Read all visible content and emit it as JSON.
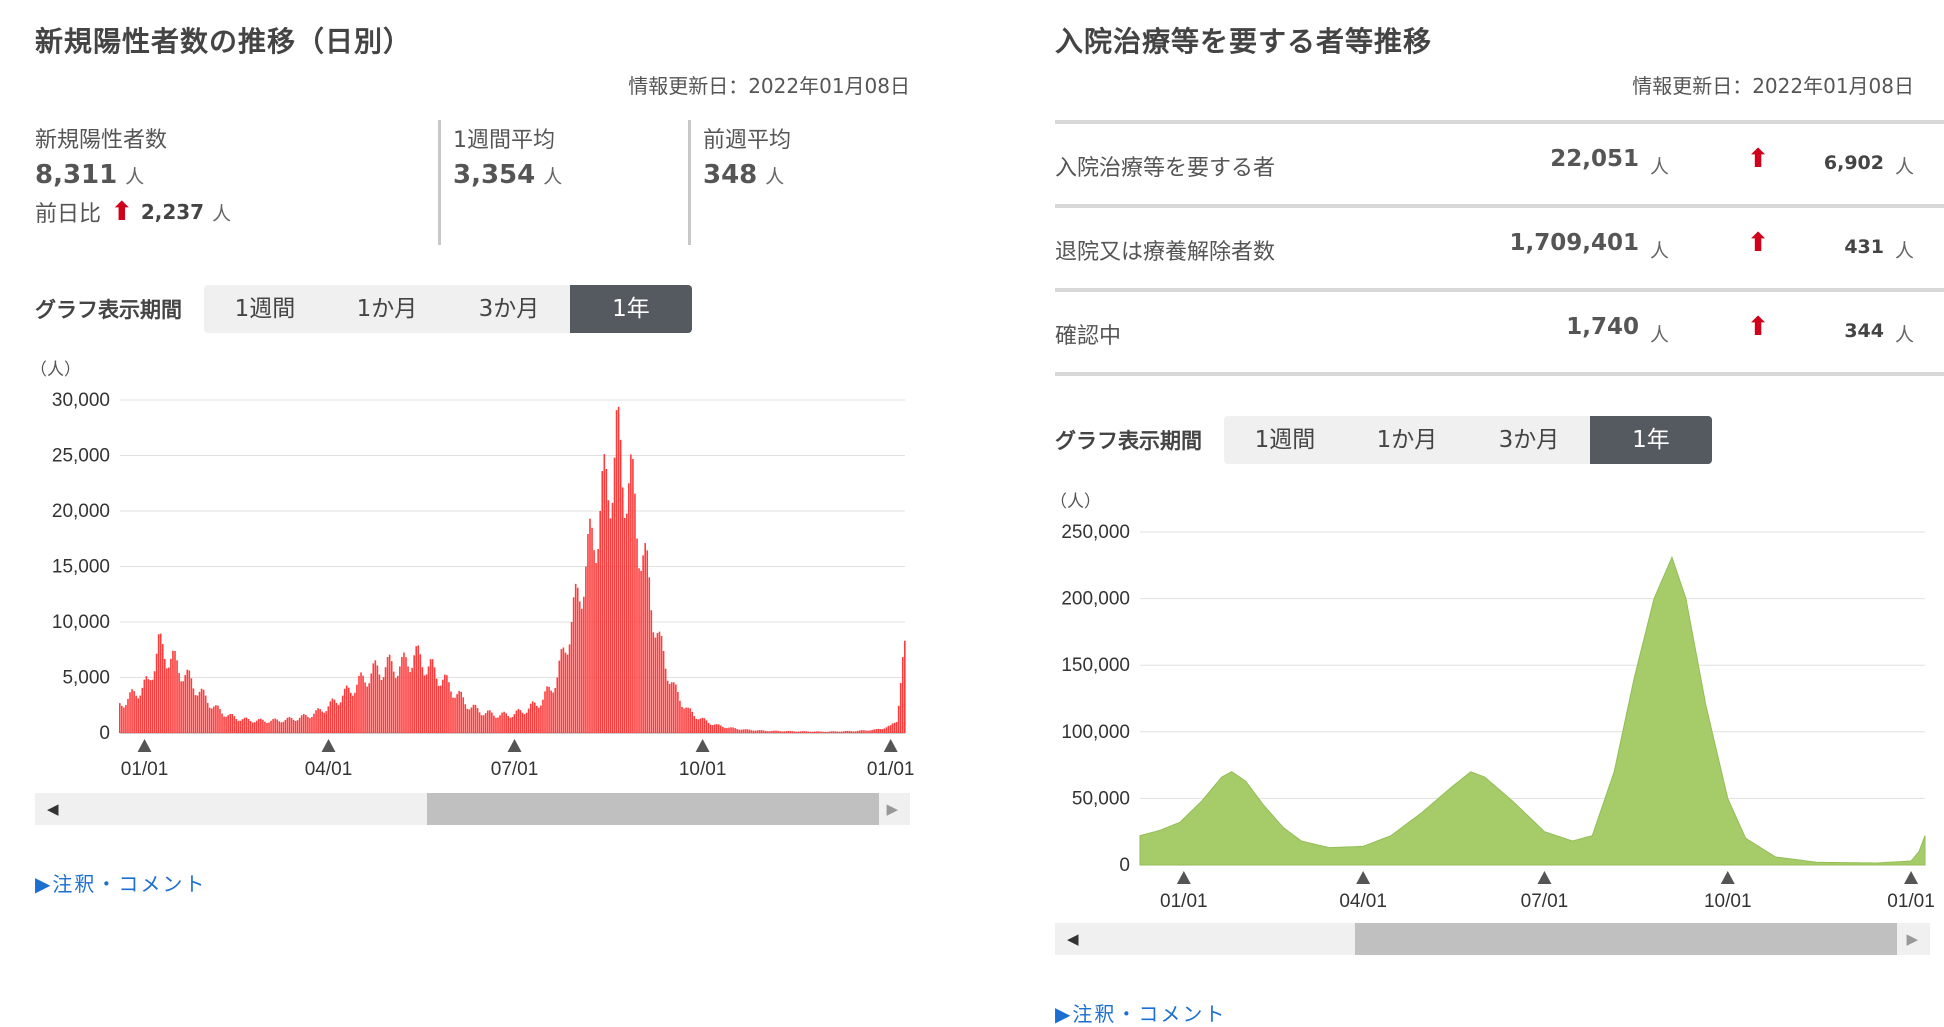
{
  "left": {
    "title": "新規陽性者数の推移（日別）",
    "updated": "情報更新日：2022年01月08日",
    "stats": {
      "new_label": "新規陽性者数",
      "new_value": "8,311",
      "unit": "人",
      "diff_label": "前日比",
      "diff_value": "2,237",
      "week_avg_label": "1週間平均",
      "week_avg_value": "3,354",
      "prev_week_label": "前週平均",
      "prev_week_value": "348"
    },
    "period_label": "グラフ表示期間",
    "period_buttons": [
      "1週間",
      "1か月",
      "3か月",
      "1年"
    ],
    "active_period": "1年",
    "note": "▶注釈・コメント"
  },
  "right": {
    "title": "入院治療等を要する者等推移",
    "updated": "情報更新日：2022年01月08日",
    "rows": [
      {
        "label": "入院治療等を要する者",
        "value": "22,051",
        "unit": "人",
        "diff": "6,902",
        "diff_unit": "人"
      },
      {
        "label": "退院又は療養解除者数",
        "value": "1,709,401",
        "unit": "人",
        "diff": "431",
        "diff_unit": "人"
      },
      {
        "label": "確認中",
        "value": "1,740",
        "unit": "人",
        "diff": "344",
        "diff_unit": "人"
      }
    ],
    "period_label": "グラフ表示期間",
    "period_buttons": [
      "1週間",
      "1か月",
      "3か月",
      "1年"
    ],
    "active_period": "1年",
    "note": "▶注釈・コメント"
  },
  "colors": {
    "red_series": "#ff3b3b",
    "green_series": "#a6cc6a",
    "active_button": "#555a60",
    "link": "#1a6fd0",
    "arrow": "#d0021b"
  },
  "chart_data": [
    {
      "type": "bar",
      "ylabel": "（人）",
      "ylim": [
        0,
        30000
      ],
      "yticks": [
        "30,000",
        "25,000",
        "20,000",
        "15,000",
        "10,000",
        "5,000",
        "0"
      ],
      "xticks": [
        "01/01",
        "04/01",
        "07/01",
        "10/01",
        "01/01"
      ],
      "x_range": [
        "2020-12-20",
        "2022-01-08"
      ],
      "series": [
        {
          "values_by_date": [
            [
              "2020-12-20",
              2500
            ],
            [
              "2020-12-27",
              3500
            ],
            [
              "2021-01-03",
              4500
            ],
            [
              "2021-01-08",
              7800
            ],
            [
              "2021-01-15",
              6500
            ],
            [
              "2021-01-22",
              5000
            ],
            [
              "2021-01-29",
              3500
            ],
            [
              "2021-02-05",
              2200
            ],
            [
              "2021-02-12",
              1500
            ],
            [
              "2021-02-19",
              1200
            ],
            [
              "2021-02-26",
              1100
            ],
            [
              "2021-03-05",
              1100
            ],
            [
              "2021-03-12",
              1200
            ],
            [
              "2021-03-19",
              1400
            ],
            [
              "2021-03-26",
              1800
            ],
            [
              "2021-04-02",
              2500
            ],
            [
              "2021-04-09",
              3500
            ],
            [
              "2021-04-16",
              4500
            ],
            [
              "2021-04-23",
              5500
            ],
            [
              "2021-04-30",
              6000
            ],
            [
              "2021-05-07",
              6000
            ],
            [
              "2021-05-13",
              7000
            ],
            [
              "2021-05-20",
              6000
            ],
            [
              "2021-05-27",
              4800
            ],
            [
              "2021-06-03",
              3500
            ],
            [
              "2021-06-10",
              2300
            ],
            [
              "2021-06-17",
              1800
            ],
            [
              "2021-06-24",
              1600
            ],
            [
              "2021-07-01",
              1700
            ],
            [
              "2021-07-08",
              2200
            ],
            [
              "2021-07-15",
              3000
            ],
            [
              "2021-07-22",
              5000
            ],
            [
              "2021-07-29",
              10000
            ],
            [
              "2021-08-05",
              15000
            ],
            [
              "2021-08-12",
              20000
            ],
            [
              "2021-08-20",
              25500
            ],
            [
              "2021-08-27",
              22000
            ],
            [
              "2021-09-03",
              15000
            ],
            [
              "2021-09-10",
              8000
            ],
            [
              "2021-09-17",
              4000
            ],
            [
              "2021-09-24",
              2000
            ],
            [
              "2021-10-01",
              1200
            ],
            [
              "2021-10-08",
              700
            ],
            [
              "2021-10-15",
              450
            ],
            [
              "2021-10-22",
              300
            ],
            [
              "2021-11-01",
              200
            ],
            [
              "2021-11-15",
              150
            ],
            [
              "2021-12-01",
              120
            ],
            [
              "2021-12-15",
              180
            ],
            [
              "2021-12-25",
              300
            ],
            [
              "2022-01-01",
              600
            ],
            [
              "2022-01-04",
              1200
            ],
            [
              "2022-01-06",
              4500
            ],
            [
              "2022-01-07",
              6000
            ],
            [
              "2022-01-08",
              8311
            ]
          ]
        }
      ]
    },
    {
      "type": "area",
      "ylabel": "（人）",
      "ylim": [
        0,
        250000
      ],
      "yticks": [
        "250,000",
        "200,000",
        "150,000",
        "100,000",
        "50,000",
        "0"
      ],
      "xticks": [
        "01/01",
        "04/01",
        "07/01",
        "10/01",
        "01/01"
      ],
      "x_range": [
        "2020-12-10",
        "2022-01-08"
      ],
      "series": [
        {
          "values_by_date": [
            [
              "2020-12-10",
              22000
            ],
            [
              "2020-12-20",
              26000
            ],
            [
              "2020-12-30",
              32000
            ],
            [
              "2021-01-10",
              48000
            ],
            [
              "2021-01-20",
              66000
            ],
            [
              "2021-01-25",
              70000
            ],
            [
              "2021-02-01",
              63000
            ],
            [
              "2021-02-10",
              45000
            ],
            [
              "2021-02-20",
              28000
            ],
            [
              "2021-03-01",
              18000
            ],
            [
              "2021-03-15",
              13000
            ],
            [
              "2021-04-01",
              14000
            ],
            [
              "2021-04-15",
              22000
            ],
            [
              "2021-05-01",
              40000
            ],
            [
              "2021-05-15",
              58000
            ],
            [
              "2021-05-25",
              70000
            ],
            [
              "2021-06-01",
              66000
            ],
            [
              "2021-06-15",
              48000
            ],
            [
              "2021-07-01",
              25000
            ],
            [
              "2021-07-15",
              18000
            ],
            [
              "2021-07-25",
              22000
            ],
            [
              "2021-08-05",
              70000
            ],
            [
              "2021-08-15",
              140000
            ],
            [
              "2021-08-25",
              200000
            ],
            [
              "2021-09-03",
              231000
            ],
            [
              "2021-09-10",
              200000
            ],
            [
              "2021-09-20",
              120000
            ],
            [
              "2021-10-01",
              50000
            ],
            [
              "2021-10-10",
              20000
            ],
            [
              "2021-10-25",
              6000
            ],
            [
              "2021-11-15",
              2000
            ],
            [
              "2021-12-15",
              1500
            ],
            [
              "2022-01-01",
              3000
            ],
            [
              "2022-01-05",
              10000
            ],
            [
              "2022-01-08",
              22051
            ]
          ]
        }
      ]
    }
  ]
}
